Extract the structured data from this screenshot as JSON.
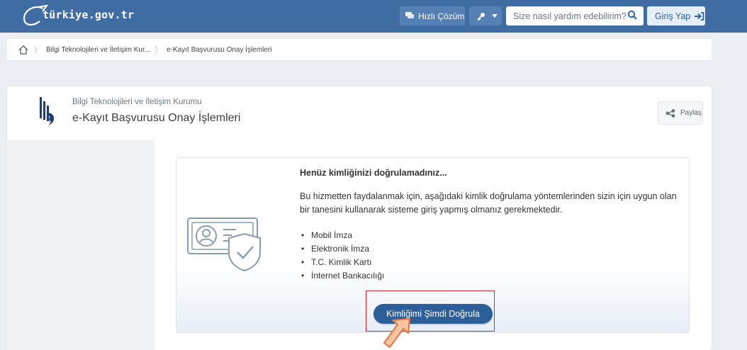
{
  "header": {
    "logo_text": "türkiye.gov.tr",
    "quick_solution_label": "Hızlı Çözüm",
    "search_placeholder": "Size nasıl yardım edebilirim?",
    "login_label": "Giriş Yap",
    "icons": [
      "chat-icon",
      "key-icon",
      "chevron-down-icon",
      "search-icon",
      "login-arrow-icon"
    ]
  },
  "breadcrumb": {
    "items": [
      "Bilgi Teknolojileri ve İletişim Kur...",
      "e-Kayıt Başvurusu Onay İşlemleri"
    ]
  },
  "service": {
    "institution": "Bilgi Teknolojileri ve İletişim Kurumu",
    "title": "e-Kayıt Başvurusu Onay İşlemleri",
    "share_label": "Paylaş"
  },
  "auth_notice": {
    "heading": "Henüz kimliğinizi doğrulamadınız...",
    "description": "Bu hizmetten faydalanmak için, aşağıdaki kimlik doğrulama yöntemlerinden sizin için uygun olan bir tanesini kullanarak sisteme giriş yapmış olmanız gerekmektedir.",
    "methods": [
      "Mobil İmza",
      "Elektronik İmza",
      "T.C. Kimlik Kartı",
      "İnternet Bankacılığı"
    ],
    "verify_button": "Kimliğimi Şimdi Doğrula"
  },
  "colors": {
    "header_bg": "#3f6da3",
    "primary_button": "#2c5f9a",
    "highlight": "#d9262c",
    "pointer": "#f08a4b"
  }
}
